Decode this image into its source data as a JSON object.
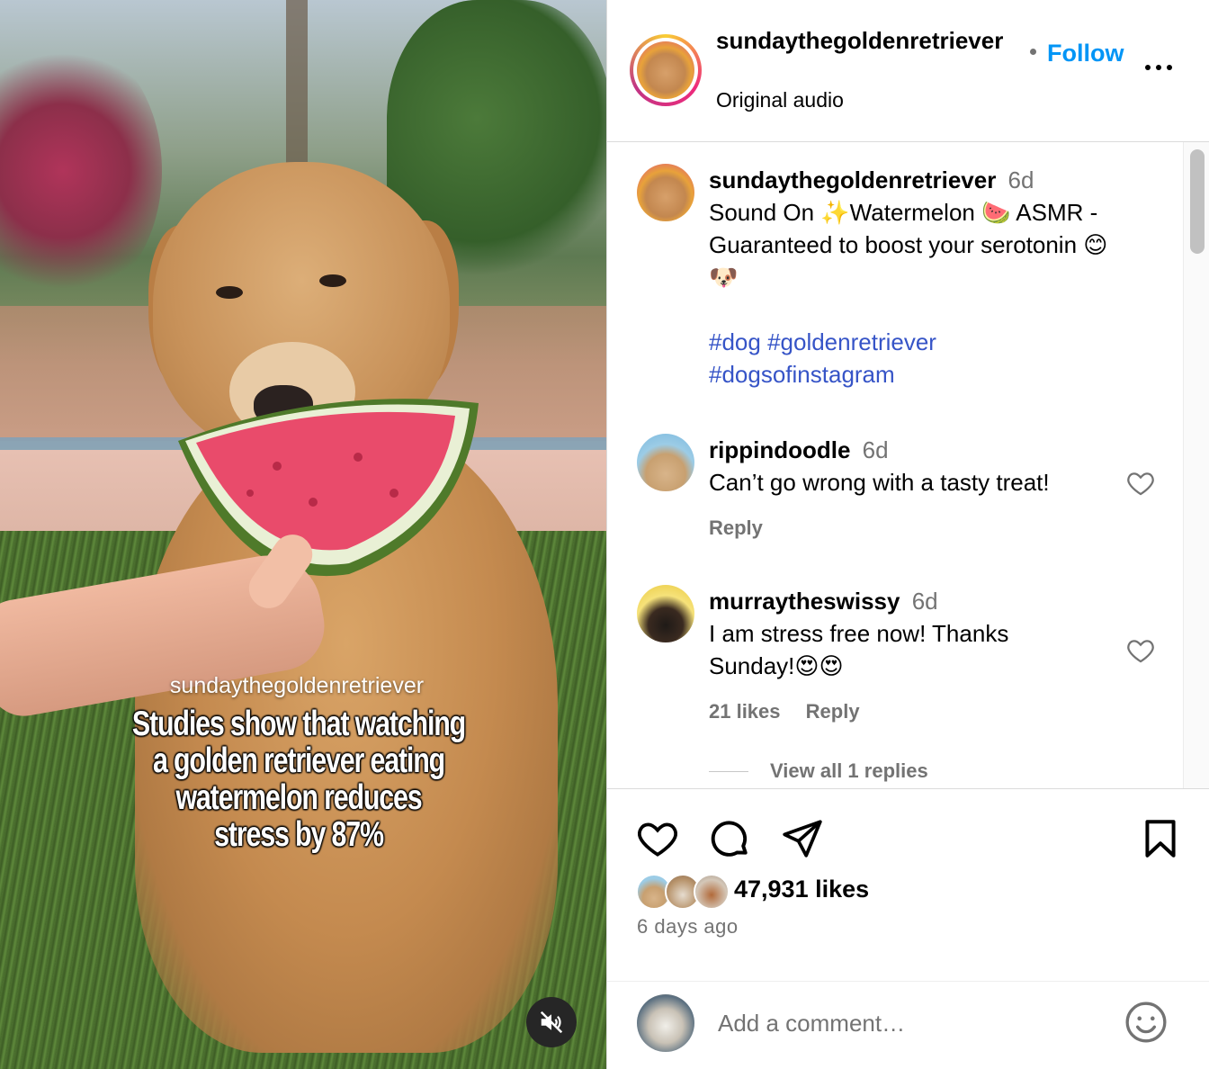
{
  "media": {
    "watermark_user": "sundaythegoldenretriever",
    "caption_lines": [
      "Studies show that watching",
      "a golden retriever eating",
      "watermelon reduces",
      "stress by 87%"
    ],
    "mute_icon": "speaker-muted-icon"
  },
  "header": {
    "username": "sundaythegoldenretriever",
    "audio": "Original audio",
    "follow_label": "Follow",
    "more_icon": "more-options-icon"
  },
  "caption": {
    "username": "sundaythegoldenretriever",
    "time": "6d",
    "text_line1": "Sound On ✨Watermelon 🍉 ASMR -",
    "text_line2": "Guaranteed to boost your serotonin 😊",
    "text_line3": "🐶",
    "hashtags_line1": "#dog #goldenretriever",
    "hashtags_line2": "#dogsofinstagram"
  },
  "comments": [
    {
      "username": "rippindoodle",
      "time": "6d",
      "text": "Can’t go wrong with a tasty treat!",
      "reply_label": "Reply"
    },
    {
      "username": "murraytheswissy",
      "time": "6d",
      "text_line1": "I am stress free now! Thanks",
      "text_line2": "Sunday!😍😍",
      "likes_label": "21 likes",
      "reply_label": "Reply",
      "view_replies": "View all 1 replies"
    }
  ],
  "actions": {
    "like_icon": "heart-icon",
    "comment_icon": "comment-bubble-icon",
    "share_icon": "paper-plane-icon",
    "save_icon": "bookmark-icon",
    "likes": "47,931 likes",
    "posted": "6 days ago"
  },
  "add_comment": {
    "placeholder": "Add a comment…",
    "emoji_icon": "smiley-icon"
  },
  "colors": {
    "follow_blue": "#0095f6",
    "hashtag_blue": "#3654c7",
    "muted_text": "#737373",
    "divider": "#dbdbdb"
  }
}
